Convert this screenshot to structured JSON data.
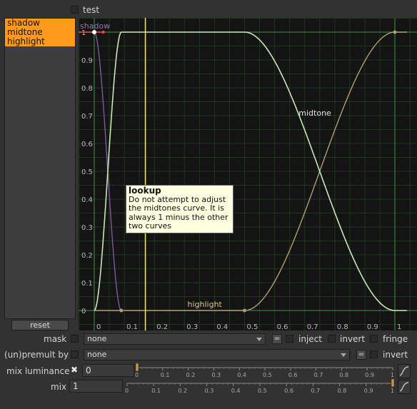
{
  "header": {
    "test_label": "test"
  },
  "sidebar": {
    "items": [
      {
        "label": "shadow"
      },
      {
        "label": "midtone"
      },
      {
        "label": "highlight"
      }
    ],
    "reset_label": "reset"
  },
  "graph": {
    "x_ticks": [
      "0",
      "0.1",
      "0.2",
      "0.3",
      "0.4",
      "0.5",
      "0.6",
      "0.7",
      "0.8",
      "0.9",
      "1"
    ],
    "y_ticks": [
      "0",
      "0.1",
      "0.2",
      "0.3",
      "0.4",
      "0.5",
      "0.6",
      "0.7",
      "0.8",
      "0.9",
      "1"
    ],
    "curve_labels": {
      "shadow": "shadow",
      "midtone": "midtone",
      "highlight": "highlight"
    },
    "colors": {
      "background": "#141414",
      "grid": "#2e4a2e",
      "shadow": "#7a5aa0",
      "midtone": "#c8e8b8",
      "highlight": "#b0a070",
      "marker": "#ffff00"
    }
  },
  "tooltip": {
    "title": "lookup",
    "body": "Do not attempt to adjust the midtones curve. It is always 1 minus the other two curves"
  },
  "controls": {
    "mask": {
      "label": "mask",
      "value": "none",
      "inject": "inject",
      "invert": "invert",
      "fringe": "fringe",
      "eq": "="
    },
    "premult": {
      "label": "(un)premult by",
      "value": "none",
      "invert": "invert",
      "eq": "="
    },
    "mix_luminance": {
      "label": "mix luminance",
      "value": "0",
      "icon": "close-icon",
      "slider_ticks": [
        "0",
        "0.1",
        "0.2",
        "0.3",
        "0.4",
        "0.5",
        "0.6",
        "0.7",
        "0.8",
        "0.9",
        "1"
      ]
    },
    "mix": {
      "label": "mix",
      "value": "1",
      "slider_ticks": [
        "0",
        "0.1",
        "0.2",
        "0.3",
        "0.4",
        "0.5",
        "0.6",
        "0.7",
        "0.8",
        "0.9",
        "1"
      ]
    }
  }
}
